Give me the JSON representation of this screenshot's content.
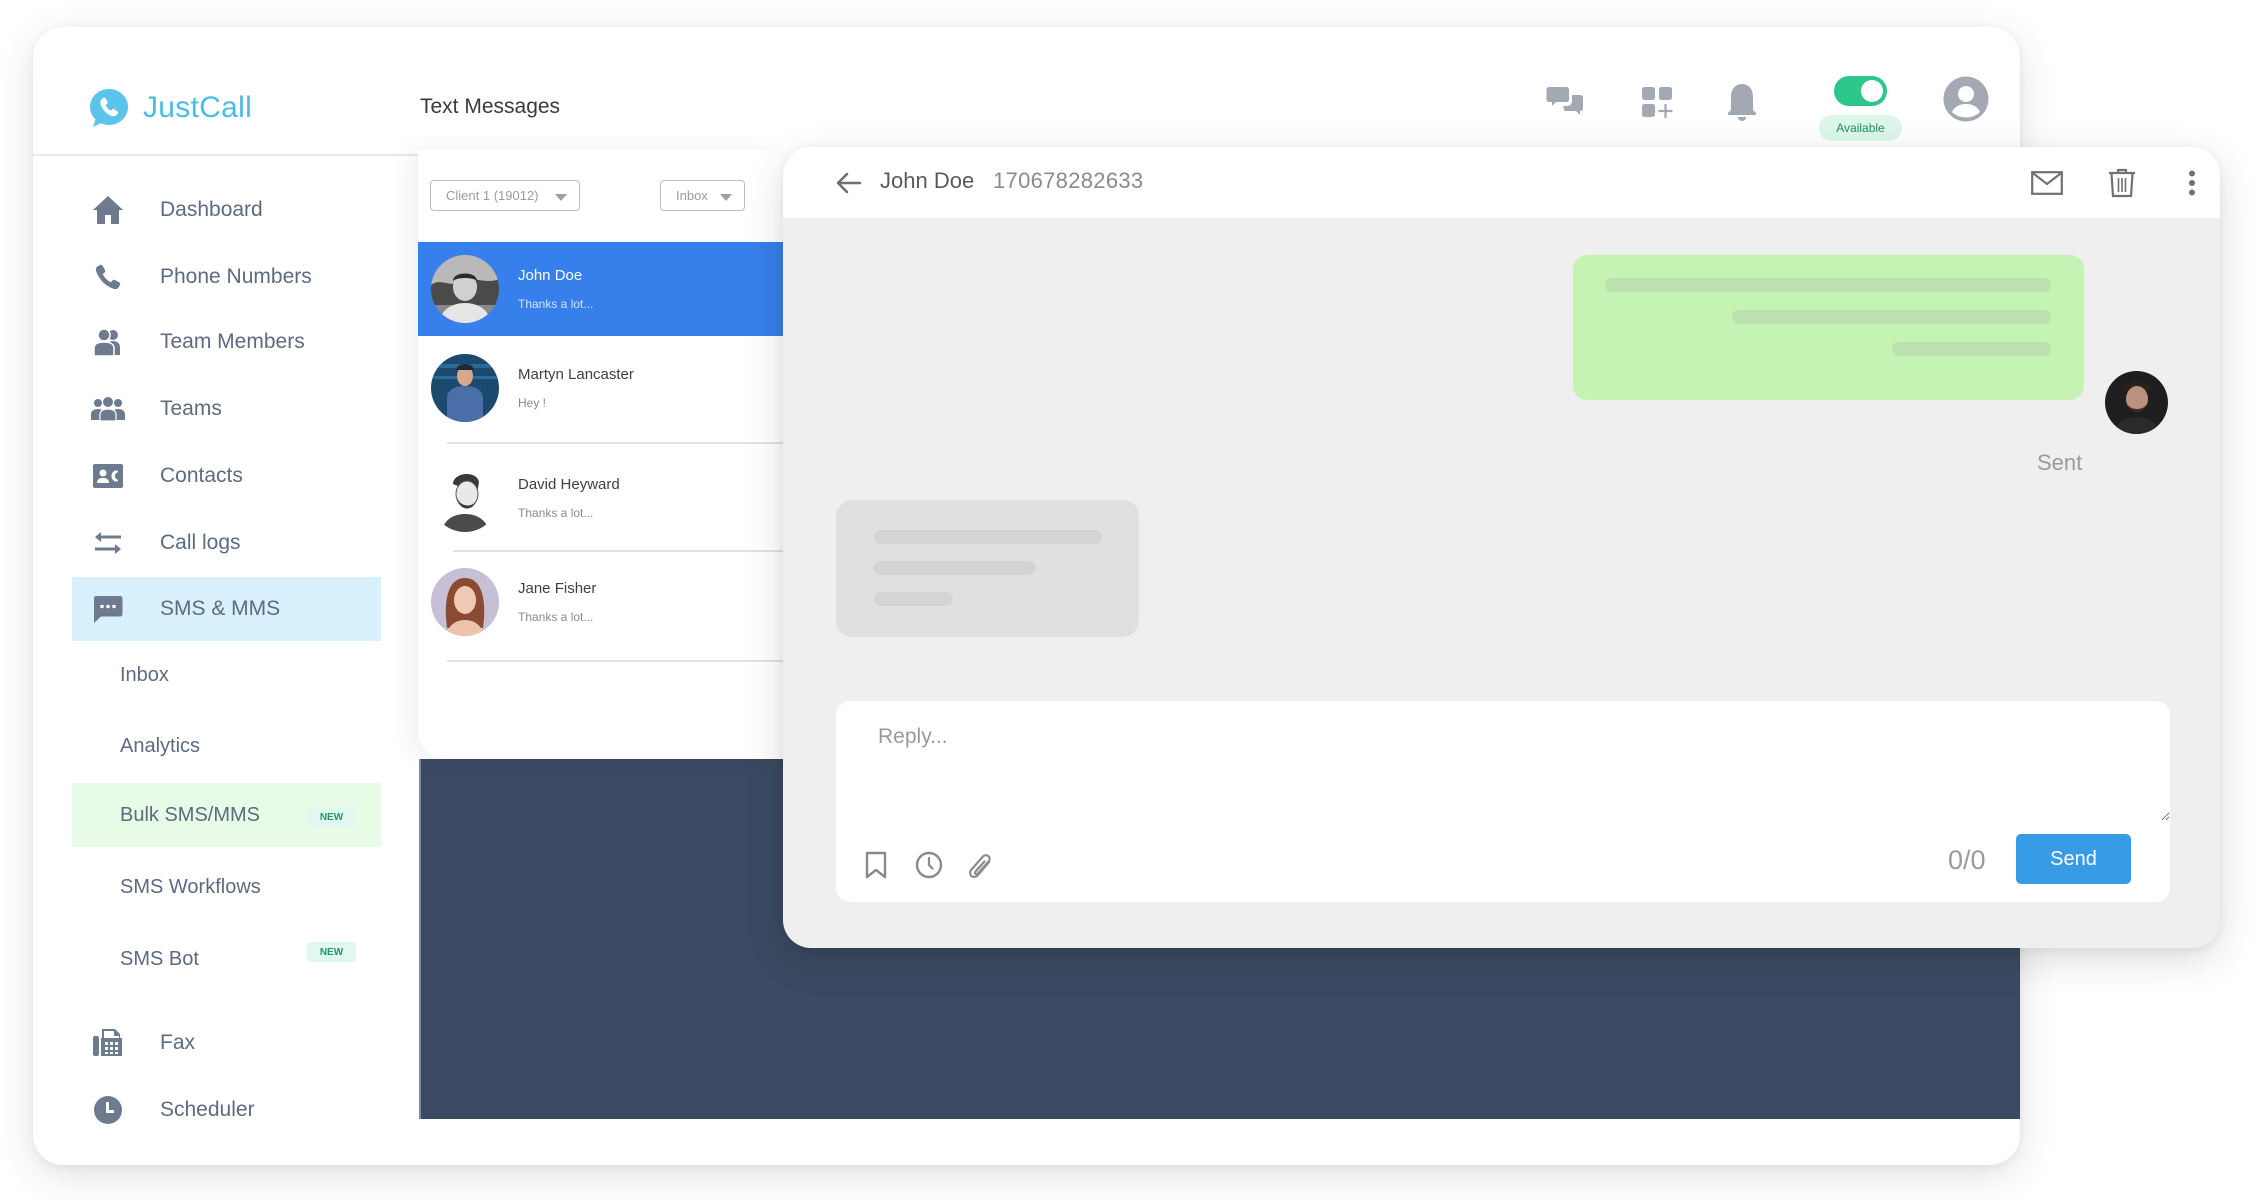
{
  "app": {
    "brand": "JustCall",
    "page_title": "Text Messages",
    "brand_color": "#4bbbe8"
  },
  "topbar": {
    "icons": [
      "chat-bubbles-icon",
      "apps-add-icon",
      "bell-icon",
      "user-avatar-icon"
    ],
    "availability_toggle": {
      "on": true,
      "label": "Available"
    }
  },
  "sidebar": {
    "items": [
      {
        "label": "Dashboard",
        "icon": "home-icon"
      },
      {
        "label": "Phone Numbers",
        "icon": "phone-icon"
      },
      {
        "label": "Team Members",
        "icon": "team-members-icon"
      },
      {
        "label": "Teams",
        "icon": "teams-icon"
      },
      {
        "label": "Contacts",
        "icon": "contacts-icon"
      },
      {
        "label": "Call logs",
        "icon": "call-logs-icon"
      },
      {
        "label": "SMS & MMS",
        "icon": "sms-icon",
        "active": true
      },
      {
        "label": "Fax",
        "icon": "fax-icon"
      },
      {
        "label": "Scheduler",
        "icon": "clock-icon"
      }
    ],
    "sms_subitems": [
      {
        "label": "Inbox"
      },
      {
        "label": "Analytics"
      },
      {
        "label": "Bulk SMS/MMS",
        "badge": "NEW",
        "highlighted": true
      },
      {
        "label": "SMS Workflows"
      },
      {
        "label": "SMS Bot",
        "badge": "NEW"
      }
    ]
  },
  "conversation_list": {
    "number_filter": "Client 1 (19012)",
    "folder_filter": "Inbox",
    "conversations": [
      {
        "name": "John Doe",
        "preview": "Thanks a lot...",
        "selected": true
      },
      {
        "name": "Martyn Lancaster",
        "preview": "Hey !"
      },
      {
        "name": "David Heyward",
        "preview": "Thanks a lot..."
      },
      {
        "name": "Jane Fisher",
        "preview": "Thanks a lot..."
      }
    ]
  },
  "chat": {
    "contact_name": "John Doe",
    "contact_number": "170678282633",
    "header_actions": [
      "mail-icon",
      "trash-icon",
      "more-vertical-icon"
    ],
    "messages": [
      {
        "direction": "sent",
        "status": "Sent",
        "placeholder_lines": 3
      },
      {
        "direction": "received",
        "placeholder_lines": 3
      }
    ],
    "reply_placeholder": "Reply...",
    "reply_value": "",
    "tools": [
      "bookmark-icon",
      "schedule-icon",
      "attachment-icon"
    ],
    "char_count": "0/0",
    "send_label": "Send"
  }
}
